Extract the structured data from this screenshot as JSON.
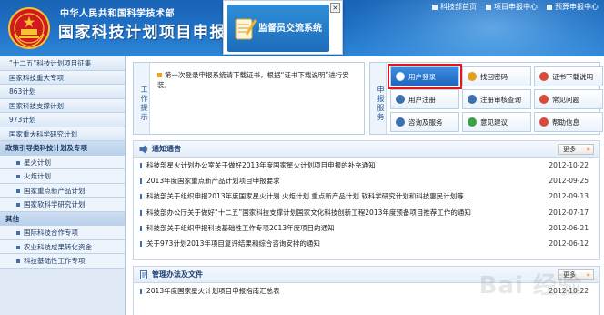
{
  "header": {
    "ministry": "中华人民共和国科学技术部",
    "title": "国家科技计划项目申报",
    "nav": [
      "科技部首页",
      "项目申报中心",
      "预算申报中心"
    ]
  },
  "ad": {
    "text": "监督员交流系统",
    "close": "×"
  },
  "sidebar": {
    "items": [
      {
        "label": "“十二五”科技计划项目征集",
        "type": "item"
      },
      {
        "label": "国家科技重大专项",
        "type": "item"
      },
      {
        "label": "863计划",
        "type": "item"
      },
      {
        "label": "国家科技支撑计划",
        "type": "item"
      },
      {
        "label": "973计划",
        "type": "item"
      },
      {
        "label": "国家重大科学研究计划",
        "type": "item"
      },
      {
        "label": "政策引导类科技计划及专项",
        "type": "cat"
      },
      {
        "label": "星火计划",
        "type": "sub"
      },
      {
        "label": "火炬计划",
        "type": "sub"
      },
      {
        "label": "国家重点新产品计划",
        "type": "sub"
      },
      {
        "label": "国家软科学研究计划",
        "type": "sub"
      },
      {
        "label": "其他",
        "type": "cat"
      },
      {
        "label": "国际科技合作专项",
        "type": "sub"
      },
      {
        "label": "农业科技成果转化资金",
        "type": "sub"
      },
      {
        "label": "科技基础性工作专项",
        "type": "sub"
      }
    ]
  },
  "notice": {
    "side_label": "工作提示",
    "text": "第一次登录申报系统请下载证书，根据“证书下载说明”进行安装。"
  },
  "services": {
    "side_label": "申报服务",
    "buttons": [
      {
        "label": "用户登录",
        "icon": "user-icon",
        "active": true
      },
      {
        "label": "找回密码",
        "icon": "key-icon",
        "active": false
      },
      {
        "label": "证书下载说明",
        "icon": "certificate-icon",
        "active": false
      },
      {
        "label": "用户注册",
        "icon": "register-icon",
        "active": false
      },
      {
        "label": "注册审核查询",
        "icon": "search-icon",
        "active": false
      },
      {
        "label": "常见问题",
        "icon": "question-icon",
        "active": false
      },
      {
        "label": "咨询及服务",
        "icon": "consult-icon",
        "active": false
      },
      {
        "label": "意见建议",
        "icon": "feedback-icon",
        "active": false
      },
      {
        "label": "帮助信息",
        "icon": "help-icon",
        "active": false
      }
    ]
  },
  "notices_panel": {
    "title": "通知通告",
    "more": "更多",
    "items": [
      {
        "title": "科技部星火计划办公室关于做好2013年度国家星火计划项目申报的补充通知",
        "date": "2012-10-22"
      },
      {
        "title": "2013年度国家重点新产品计划项目申报要求",
        "date": "2012-09-25"
      },
      {
        "title": "科技部关于组织申报2013年度国家星火计划 火炬计划 重点新产品计划 软科学研究计划和科技惠民计划等...",
        "date": "2012-09-13"
      },
      {
        "title": "科技部办公厅关于做好“十二五”国家科技支撑计划国家文化科技创新工程2013年度预备项目推荐工作的通知",
        "date": "2012-07-17"
      },
      {
        "title": "科技部关于组织申报科技基础性工作专项2013年度项目的通知",
        "date": "2012-06-21"
      },
      {
        "title": "关于973计划2013年项目复评结果和综合咨询安排的通知",
        "date": "2012-06-12"
      }
    ]
  },
  "rules_panel": {
    "title": "管理办法及文件",
    "more": "更多",
    "items": [
      {
        "title": "2013年度国家星火计划项目申报指南汇总表",
        "date": "2012-10-22"
      }
    ]
  },
  "watermark": "Bai 经验",
  "colors": {
    "brand_blue": "#1e6fc4",
    "highlight_red": "#e8141c",
    "arrow_orange": "#f08010"
  }
}
